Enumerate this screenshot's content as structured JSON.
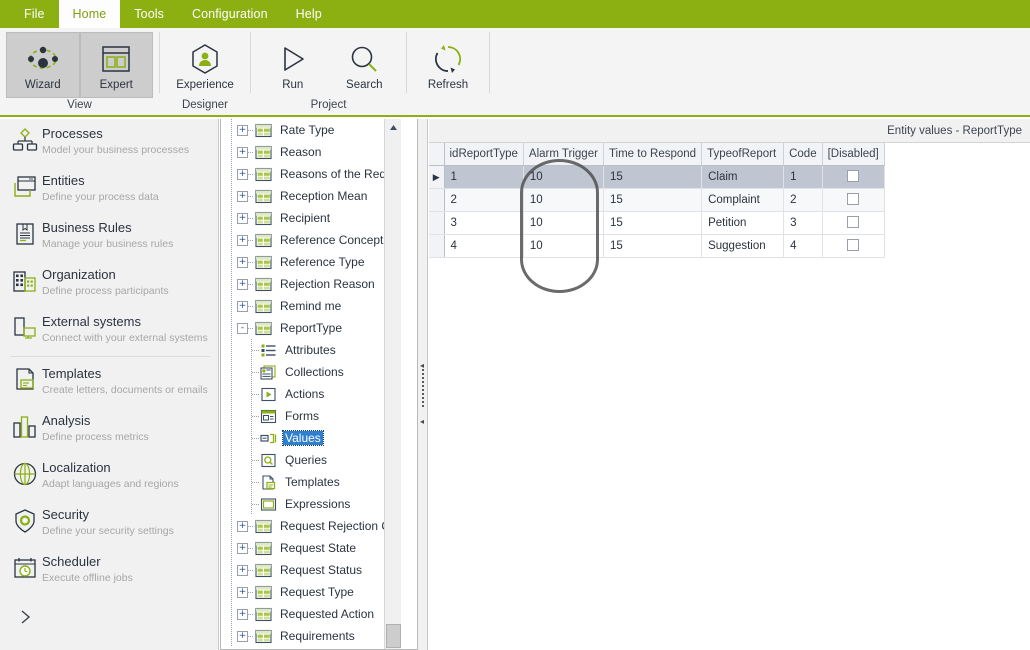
{
  "menu": {
    "tabs": [
      {
        "label": "File",
        "active": false
      },
      {
        "label": "Home",
        "active": true
      },
      {
        "label": "Tools",
        "active": false
      },
      {
        "label": "Configuration",
        "active": false
      },
      {
        "label": "Help",
        "active": false
      }
    ]
  },
  "ribbon": {
    "groups": [
      {
        "label": "View",
        "buttons": [
          {
            "label": "Wizard",
            "icon": "wizard-icon",
            "selected": true
          },
          {
            "label": "Expert",
            "icon": "expert-icon",
            "selected": true
          }
        ]
      },
      {
        "label": "Designer",
        "buttons": [
          {
            "label": "Experience",
            "icon": "experience-icon",
            "selected": false
          }
        ]
      },
      {
        "label": "Project",
        "buttons": [
          {
            "label": "Run",
            "icon": "run-icon",
            "selected": false
          },
          {
            "label": "Search",
            "icon": "search-icon",
            "selected": false
          }
        ]
      },
      {
        "label": "",
        "buttons": [
          {
            "label": "Refresh",
            "icon": "refresh-icon",
            "selected": false
          }
        ]
      }
    ]
  },
  "sidebar": {
    "items": [
      {
        "title": "Processes",
        "subtitle": "Model your business processes",
        "icon": "processes-icon"
      },
      {
        "title": "Entities",
        "subtitle": "Define your process data",
        "icon": "entities-icon"
      },
      {
        "title": "Business Rules",
        "subtitle": "Manage your business rules",
        "icon": "business-rules-icon"
      },
      {
        "title": "Organization",
        "subtitle": "Define process participants",
        "icon": "organization-icon"
      },
      {
        "title": "External systems",
        "subtitle": "Connect with your external systems",
        "icon": "external-systems-icon"
      },
      {
        "title": "Templates",
        "subtitle": "Create letters, documents  or emails",
        "icon": "templates-icon"
      },
      {
        "title": "Analysis",
        "subtitle": "Define  process  metrics",
        "icon": "analysis-icon"
      },
      {
        "title": "Localization",
        "subtitle": "Adapt  languages  and regions",
        "icon": "localization-icon"
      },
      {
        "title": "Security",
        "subtitle": "Define  your security settings",
        "icon": "security-icon"
      },
      {
        "title": "Scheduler",
        "subtitle": "Execute offline  jobs",
        "icon": "scheduler-icon"
      }
    ],
    "expander_icon": "chevron-right-icon"
  },
  "tree": {
    "nodes": [
      {
        "label": "Rate Type",
        "level": 0,
        "expander": "+",
        "icon": "entity-icon",
        "selected": false
      },
      {
        "label": "Reason",
        "level": 0,
        "expander": "+",
        "icon": "entity-icon",
        "selected": false
      },
      {
        "label": "Reasons of the Request",
        "level": 0,
        "expander": "+",
        "icon": "entity-icon",
        "selected": false
      },
      {
        "label": "Reception Mean",
        "level": 0,
        "expander": "+",
        "icon": "entity-icon",
        "selected": false
      },
      {
        "label": "Recipient",
        "level": 0,
        "expander": "+",
        "icon": "entity-icon",
        "selected": false
      },
      {
        "label": "Reference Concept",
        "level": 0,
        "expander": "+",
        "icon": "entity-icon",
        "selected": false
      },
      {
        "label": "Reference Type",
        "level": 0,
        "expander": "+",
        "icon": "entity-icon",
        "selected": false
      },
      {
        "label": "Rejection Reason",
        "level": 0,
        "expander": "+",
        "icon": "entity-icon",
        "selected": false
      },
      {
        "label": "Remind me",
        "level": 0,
        "expander": "+",
        "icon": "entity-icon",
        "selected": false
      },
      {
        "label": "ReportType",
        "level": 0,
        "expander": "-",
        "icon": "entity-icon",
        "selected": false
      },
      {
        "label": "Attributes",
        "level": 1,
        "expander": "",
        "icon": "attributes-icon",
        "selected": false
      },
      {
        "label": "Collections",
        "level": 1,
        "expander": "",
        "icon": "collections-icon",
        "selected": false
      },
      {
        "label": "Actions",
        "level": 1,
        "expander": "",
        "icon": "actions-icon",
        "selected": false
      },
      {
        "label": "Forms",
        "level": 1,
        "expander": "",
        "icon": "forms-icon",
        "selected": false
      },
      {
        "label": "Values",
        "level": 1,
        "expander": "",
        "icon": "values-icon",
        "selected": true
      },
      {
        "label": "Queries",
        "level": 1,
        "expander": "",
        "icon": "queries-icon",
        "selected": false
      },
      {
        "label": "Templates",
        "level": 1,
        "expander": "",
        "icon": "templates-node-icon",
        "selected": false
      },
      {
        "label": "Expressions",
        "level": 1,
        "expander": "",
        "icon": "expressions-icon",
        "selected": false
      },
      {
        "label": "Request Rejection Caus",
        "level": 0,
        "expander": "+",
        "icon": "entity-icon",
        "selected": false
      },
      {
        "label": "Request State",
        "level": 0,
        "expander": "+",
        "icon": "entity-icon",
        "selected": false
      },
      {
        "label": "Request Status",
        "level": 0,
        "expander": "+",
        "icon": "entity-icon",
        "selected": false
      },
      {
        "label": "Request Type",
        "level": 0,
        "expander": "+",
        "icon": "entity-icon",
        "selected": false
      },
      {
        "label": "Requested Action",
        "level": 0,
        "expander": "+",
        "icon": "entity-icon",
        "selected": false
      },
      {
        "label": "Requirements",
        "level": 0,
        "expander": "+",
        "icon": "entity-icon",
        "selected": false
      }
    ]
  },
  "main": {
    "title": "Entity values - ReportType",
    "grid": {
      "columns": [
        "idReportType",
        "Alarm Trigger",
        "Time to Respond",
        "TypeofReport",
        "Code",
        "[Disabled]"
      ],
      "rows": [
        {
          "cells": [
            "1",
            "10",
            "15",
            "Claim",
            "1"
          ],
          "disabled": false,
          "selected": true
        },
        {
          "cells": [
            "2",
            "10",
            "15",
            "Complaint",
            "2"
          ],
          "disabled": false,
          "selected": false
        },
        {
          "cells": [
            "3",
            "10",
            "15",
            "Petition",
            "3"
          ],
          "disabled": false,
          "selected": false
        },
        {
          "cells": [
            "4",
            "10",
            "15",
            "Suggestion",
            "4"
          ],
          "disabled": false,
          "selected": false
        }
      ],
      "row_marker": "▶",
      "annotation": {
        "shape": "oval",
        "target_column": "Alarm Trigger",
        "color": "#4b4b4b"
      }
    }
  },
  "colors": {
    "brand_green": "#8cb012",
    "accent_green": "#8cb012",
    "dark_navy": "#2b3340",
    "selection_blue": "#2f7fd1",
    "row_selection": "#bfc6d1"
  }
}
